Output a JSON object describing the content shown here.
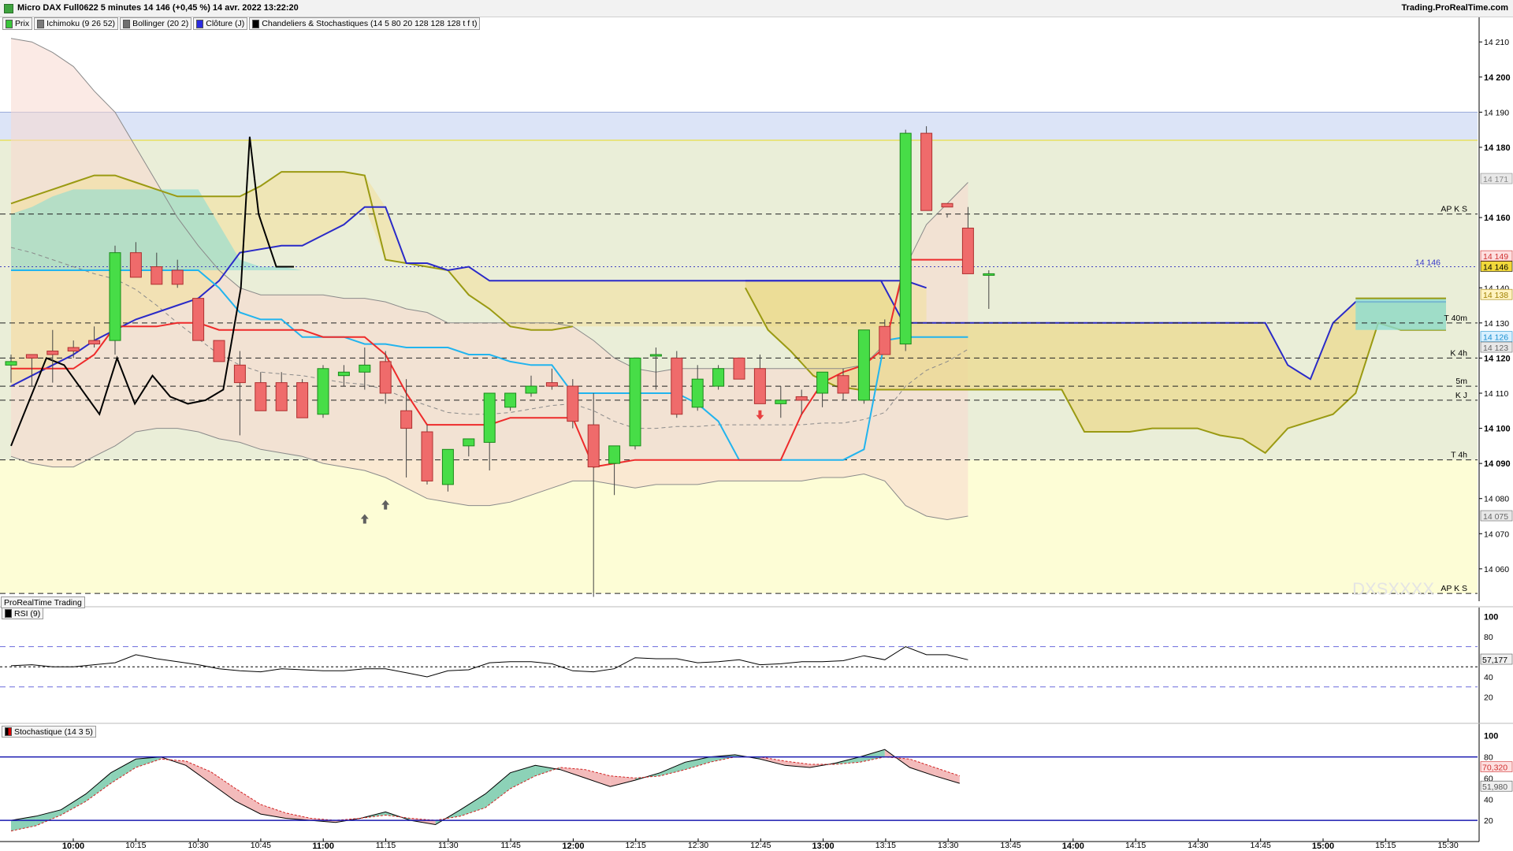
{
  "window": {
    "title": "Micro DAX Full0622 5 minutes 14 146 (+0,45 %) 14 avr. 2022 13:22:20",
    "site": "Trading.ProRealTime.com"
  },
  "legend": [
    {
      "label": "Prix",
      "color": "#39c639"
    },
    {
      "label": "Ichimoku (9 26 52)",
      "color": "#7a7a7a"
    },
    {
      "label": "Bollinger (20 2)",
      "color": "#6f6f6f"
    },
    {
      "label": "Clôture (J)",
      "color": "#2a2ae0"
    },
    {
      "label": "Chandeliers & Stochastiques (14 5 80 20 128 128 128 t f t)",
      "color": "#000000"
    }
  ],
  "watermark": "DXSXXXX",
  "source_label": "ProRealTime Trading",
  "rsi_label": "RSI (9)",
  "stoch_label": "Stochastique (14 3 5)",
  "colors": {
    "up": "#47dd47",
    "down": "#ef6b6b",
    "tenkan": "#ee2b2b",
    "kijun": "#22b4ee",
    "close_j": "#2a2ac8",
    "senkou_b": "#9a9a12"
  },
  "chart_data": [
    {
      "type": "candlestick",
      "title": "Micro DAX Full0622 5 minutes",
      "ylim": [
        14051,
        14217
      ],
      "y_ticks": [
        14060,
        14070,
        14080,
        14090,
        14100,
        14110,
        14120,
        14130,
        14140,
        14160,
        14180,
        14190,
        14200,
        14210
      ],
      "y_ticks_bold": [
        14090,
        14100,
        14120,
        14160,
        14180,
        14200
      ],
      "x_ticks": [
        "10:00",
        "10:15",
        "10:30",
        "10:45",
        "11:00",
        "11:15",
        "11:30",
        "11:45",
        "12:00",
        "12:15",
        "12:30",
        "12:45",
        "13:00",
        "13:15",
        "13:30",
        "13:45",
        "14:00",
        "14:15",
        "14:30",
        "14:45",
        "15:00",
        "15:15",
        "15:30"
      ],
      "x_ticks_bold": [
        "10:00",
        "11:00",
        "12:00",
        "13:00",
        "14:00",
        "15:00"
      ],
      "candles": [
        [
          14118,
          14121,
          14113,
          14119
        ],
        [
          14121,
          14121,
          14112,
          14120
        ],
        [
          14122,
          14128,
          14113,
          14121
        ],
        [
          14123,
          14125,
          14120,
          14122
        ],
        [
          14125,
          14129,
          14123,
          14124
        ],
        [
          14125,
          14152,
          14121,
          14150
        ],
        [
          14150,
          14153,
          14146,
          14143
        ],
        [
          14146,
          14150,
          14142,
          14141
        ],
        [
          14145,
          14148,
          14140,
          14141
        ],
        [
          14137,
          14136,
          14125,
          14125
        ],
        [
          14125,
          14124,
          14119,
          14119
        ],
        [
          14118,
          14122,
          14098,
          14113
        ],
        [
          14113,
          14116,
          14106,
          14105
        ],
        [
          14113,
          14116,
          14106,
          14105
        ],
        [
          14113,
          14114,
          14106,
          14103
        ],
        [
          14104,
          14118,
          14103,
          14117
        ],
        [
          14115,
          14118,
          14112,
          14116
        ],
        [
          14116,
          14123,
          14111,
          14118
        ],
        [
          14119,
          14122,
          14107,
          14110
        ],
        [
          14105,
          14114,
          14086,
          14100
        ],
        [
          14099,
          14101,
          14084,
          14085
        ],
        [
          14084,
          14092,
          14082,
          14094
        ],
        [
          14095,
          14097,
          14092,
          14097
        ],
        [
          14096,
          14105,
          14088,
          14110
        ],
        [
          14106,
          14110,
          14105,
          14110
        ],
        [
          14110,
          14115,
          14109,
          14112
        ],
        [
          14113,
          14117,
          14111,
          14112
        ],
        [
          14112,
          14114,
          14100,
          14102
        ],
        [
          14101,
          14110,
          14052,
          14089
        ],
        [
          14090,
          14094,
          14081,
          14095
        ],
        [
          14095,
          14120,
          14094,
          14120
        ],
        [
          14121,
          14123,
          14111,
          14121
        ],
        [
          14120,
          14122,
          14103,
          14104
        ],
        [
          14106,
          14118,
          14105,
          14114
        ],
        [
          14112,
          14118,
          14111,
          14117
        ],
        [
          14120,
          14118,
          14115,
          14114
        ],
        [
          14117,
          14121,
          14109,
          14107
        ],
        [
          14107,
          14112,
          14103,
          14108
        ],
        [
          14109,
          14111,
          14104,
          14108
        ],
        [
          14110,
          14114,
          14106,
          14116
        ],
        [
          14115,
          14117,
          14108,
          14110
        ],
        [
          14108,
          14128,
          14107,
          14128
        ],
        [
          14129,
          14131,
          14122,
          14121
        ],
        [
          14124,
          14185,
          14122,
          14184
        ],
        [
          14184,
          14186,
          14174,
          14162
        ],
        [
          14164,
          14160,
          14161,
          14163
        ],
        [
          14157,
          14163,
          14149,
          14144
        ],
        [
          14144,
          14145,
          14134,
          14144
        ]
      ],
      "tenkan": [
        14117,
        14117,
        14117,
        14117,
        14121,
        14129,
        14129,
        14129,
        14130,
        14130,
        14128,
        14128,
        14128,
        14128,
        14128,
        14126,
        14126,
        14126,
        14121,
        14110,
        14101,
        14101,
        14101,
        14101,
        14103,
        14103,
        14103,
        14103,
        14089,
        14090,
        14091,
        14091,
        14091,
        14091,
        14091,
        14091,
        14091,
        14091,
        14104,
        14113,
        14116,
        14118,
        14123,
        14148,
        14148,
        14148,
        14148
      ],
      "kijun": [
        14145,
        14145,
        14145,
        14145,
        14145,
        14145,
        14145,
        14145,
        14145,
        14145,
        14140,
        14133,
        14131,
        14131,
        14126,
        14126,
        14126,
        14124,
        14124,
        14123,
        14123,
        14123,
        14121,
        14121,
        14119,
        14118,
        14118,
        14110,
        14110,
        14110,
        14110,
        14110,
        14110,
        14107,
        14102,
        14091,
        14091,
        14091,
        14091,
        14091,
        14091,
        14094,
        14125,
        14126,
        14126,
        14126,
        14126
      ],
      "close_j": [
        14112,
        14115,
        14118,
        14121,
        14125,
        14128,
        14131,
        14133,
        14135,
        14137,
        14142,
        14150,
        14151,
        14152,
        14152,
        14155,
        14158,
        14163,
        14163,
        14147,
        14147,
        14145,
        14146,
        14142,
        14142,
        14142,
        14142,
        14142,
        14142,
        14142,
        14142,
        14142,
        14142,
        14142,
        14142,
        14142,
        14142,
        14142,
        14142,
        14142,
        14142,
        14142,
        14142,
        14142,
        14140
      ],
      "senkou_b": [
        14164,
        14166,
        14168,
        14170,
        14172,
        14172,
        14170,
        14168,
        14166,
        14166,
        14166,
        14166,
        14169,
        14173,
        14173,
        14173,
        14173,
        14172,
        14148,
        14147,
        14146,
        14145,
        14138,
        14134,
        14129,
        14128,
        14128,
        14129
      ],
      "chikou": [
        14095,
        14120,
        14118,
        14104,
        14120,
        14107,
        14115,
        14109,
        14107,
        14108,
        14111,
        14140,
        14183,
        14161,
        14158,
        14146,
        14146
      ],
      "levels": [
        {
          "label": "AP K S",
          "value": 14161
        },
        {
          "label": "T 40m",
          "value": 14130
        },
        {
          "label": "K 4h",
          "value": 14120
        },
        {
          "label": "5m",
          "value": 14112
        },
        {
          "label": "K J",
          "value": 14108
        },
        {
          "label": "T 4h",
          "value": 14091
        },
        {
          "label": "AP K S",
          "value": 14053
        }
      ],
      "price_marker": {
        "label": "14 146",
        "value": 14146
      },
      "right_tags": [
        {
          "label": "14 171",
          "value": 14171,
          "bg": "#e8e8e8",
          "fg": "#888888"
        },
        {
          "label": "14 149",
          "value": 14149,
          "bg": "#fde0e0",
          "fg": "#d03030"
        },
        {
          "label": "14 146",
          "value": 14146,
          "bg": "#f2d93a",
          "fg": "#000000"
        },
        {
          "label": "14 138",
          "value": 14138,
          "bg": "#fff3c0",
          "fg": "#a08000"
        },
        {
          "label": "14 126",
          "value": 14126,
          "bg": "#d8f0ff",
          "fg": "#1a8fd0"
        },
        {
          "label": "14 123",
          "value": 14123,
          "bg": "#e8e8e8",
          "fg": "#666666"
        },
        {
          "label": "14 075",
          "value": 14075,
          "bg": "#e8e8e8",
          "fg": "#666666"
        }
      ]
    },
    {
      "type": "line",
      "title": "RSI (9)",
      "ylim": [
        0,
        105
      ],
      "y_ticks": [
        100,
        80,
        60,
        40,
        20
      ],
      "levels": [
        70,
        50,
        30
      ],
      "current_label": "57,177",
      "values": [
        51,
        52,
        50,
        50,
        52,
        54,
        62,
        58,
        55,
        52,
        48,
        46,
        45,
        48,
        47,
        46,
        46,
        48,
        48,
        44,
        40,
        46,
        47,
        54,
        55,
        55,
        53,
        46,
        45,
        48,
        59,
        58,
        58,
        54,
        55,
        57,
        52,
        53,
        55,
        55,
        56,
        61,
        57,
        70,
        62,
        62,
        57
      ]
    },
    {
      "type": "area",
      "title": "Stochastique (14 3 5)",
      "ylim": [
        0,
        105
      ],
      "y_ticks": [
        100,
        80,
        60,
        40,
        20
      ],
      "levels": [
        80,
        20
      ],
      "labels": [
        "70,320",
        "51,980"
      ],
      "k": [
        20,
        24,
        30,
        45,
        65,
        78,
        80,
        72,
        55,
        38,
        26,
        22,
        20,
        18,
        22,
        28,
        20,
        16,
        30,
        45,
        65,
        72,
        68,
        60,
        52,
        58,
        65,
        75,
        80,
        82,
        78,
        72,
        70,
        74,
        80,
        87,
        70,
        62,
        55
      ],
      "d": [
        10,
        15,
        25,
        38,
        55,
        70,
        78,
        76,
        66,
        50,
        35,
        27,
        22,
        20,
        22,
        25,
        22,
        20,
        24,
        32,
        50,
        62,
        70,
        68,
        62,
        60,
        62,
        68,
        75,
        80,
        80,
        76,
        73,
        73,
        75,
        80,
        78,
        70,
        62
      ]
    }
  ]
}
